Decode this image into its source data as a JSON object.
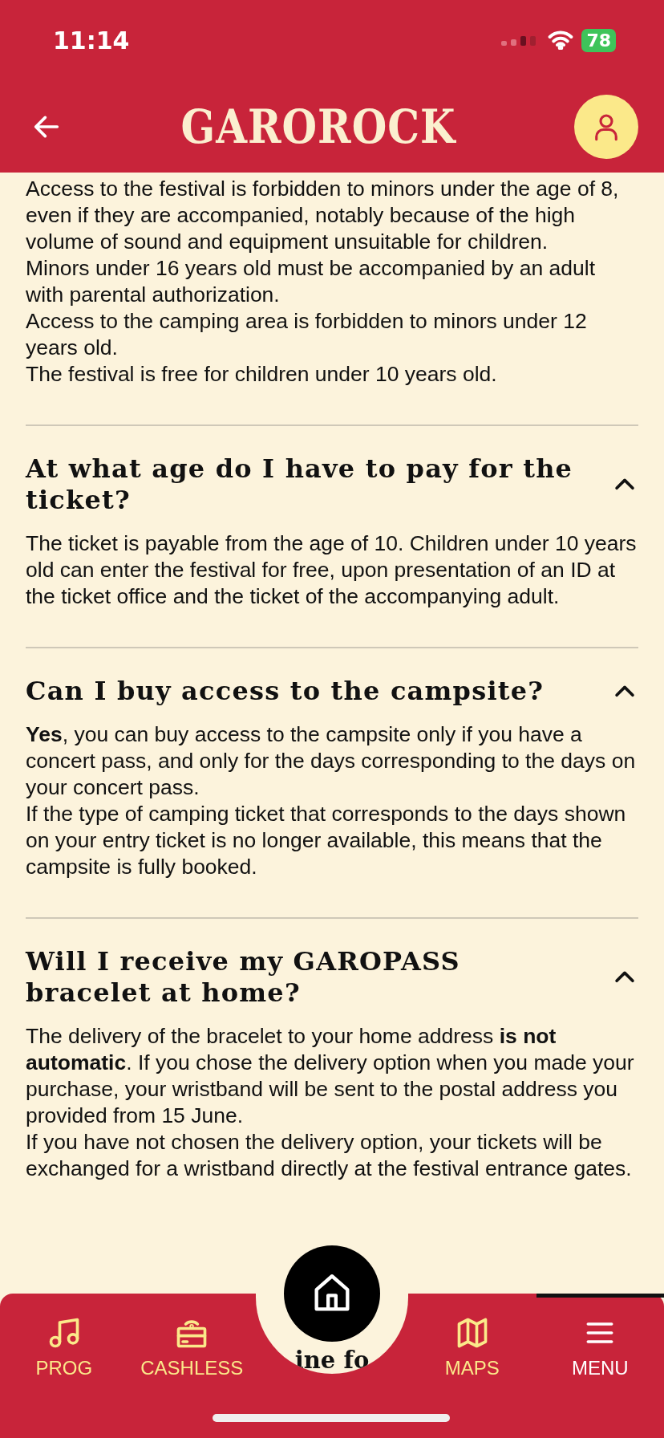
{
  "status_bar": {
    "time": "11:14",
    "battery": "78"
  },
  "header": {
    "logo": "GAROROCK"
  },
  "intro": [
    "Access to the festival is forbidden to minors under the age of 8, even if they are accompanied, notably because of the high volume of sound and equipment unsuitable for children.",
    "Minors under 16 years old must be accompanied by an adult with parental authorization.",
    "Access to the camping area is forbidden to minors under 12 years old.",
    "The festival is free for children under 10 years old."
  ],
  "faq": [
    {
      "question": "At what age do I have to pay for the ticket?",
      "expanded": true,
      "answer": [
        "The ticket is payable from the age of 10. Children under 10 years old can enter the festival for free, upon presentation of an ID at the ticket office and the ticket of the accompanying adult."
      ]
    },
    {
      "question": "Can I buy access to the campsite?",
      "expanded": true,
      "answer": [
        "**Yes**, you can buy access to the campsite only if you have a concert pass, and only for the days corresponding to the days on your concert pass.",
        "If the type of camping ticket that corresponds to the days shown on your entry ticket is no longer available, this means that the campsite is fully booked."
      ]
    },
    {
      "question": "Will I receive my GAROPASS bracelet at home?",
      "expanded": true,
      "answer": [
        "The delivery of the bracelet to your home address **is not automatic**. If you chose the delivery option when you made your purchase, your wristband will be sent to the postal address you provided from 15 June.",
        "If you have not chosen the delivery option, your tickets will be exchanged for a wristband directly at the festival entrance gates."
      ]
    }
  ],
  "peek_text": "ine fo",
  "nav": [
    {
      "kind": "prog",
      "label": "PROG",
      "selected": false
    },
    {
      "kind": "cashless",
      "label": "CASHLESS",
      "selected": false
    },
    {
      "kind": "home",
      "selected": false
    },
    {
      "kind": "maps",
      "label": "MAPS",
      "selected": false
    },
    {
      "kind": "menu",
      "label": "MENU",
      "selected": true
    }
  ]
}
